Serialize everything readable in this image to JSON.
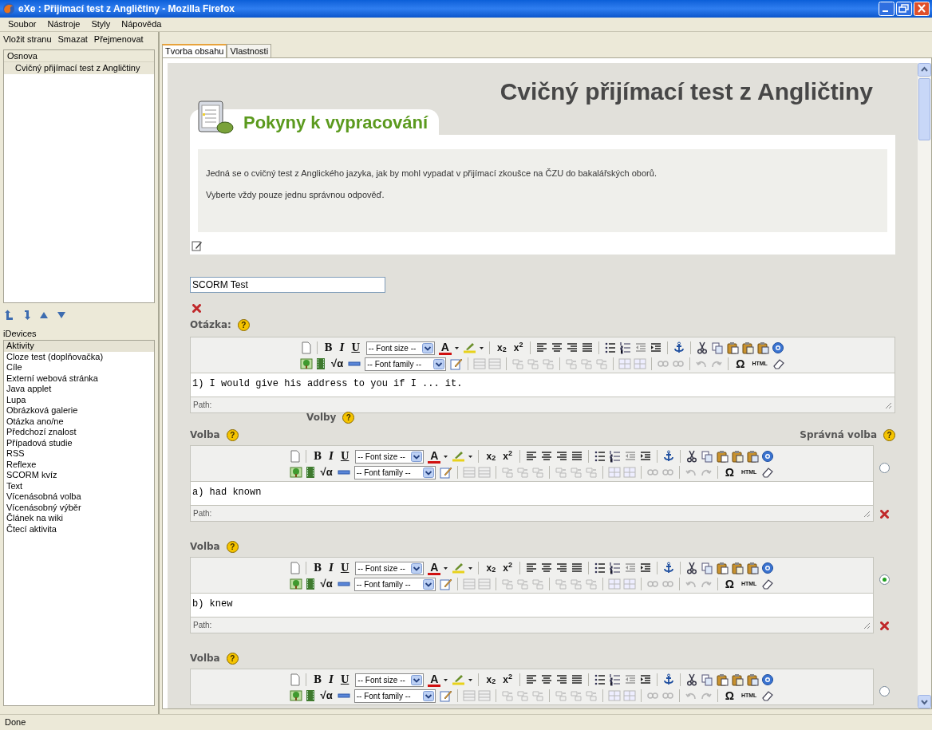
{
  "window": {
    "title": "eXe : Přijímací test z Angličtiny - Mozilla Firefox"
  },
  "menu": [
    "Soubor",
    "Nástroje",
    "Styly",
    "Nápověda"
  ],
  "outline_toolbar": [
    "Vložit stranu",
    "Smazat",
    "Přejmenovat"
  ],
  "outline": {
    "title": "Osnova",
    "children": [
      {
        "label": "Cvičný přijímací test z Angličtiny",
        "selected": true
      }
    ]
  },
  "idevices": {
    "title": "iDevices",
    "items": [
      {
        "label": "Aktivity",
        "selected": true
      },
      {
        "label": "Cloze test (doplňovačka)",
        "selected": false
      },
      {
        "label": "Cíle",
        "selected": false
      },
      {
        "label": "Externí webová stránka",
        "selected": false
      },
      {
        "label": "Java applet",
        "selected": false
      },
      {
        "label": "Lupa",
        "selected": false
      },
      {
        "label": "Obrázková galerie",
        "selected": false
      },
      {
        "label": "Otázka ano/ne",
        "selected": false
      },
      {
        "label": "Předchozí znalost",
        "selected": false
      },
      {
        "label": "Případová studie",
        "selected": false
      },
      {
        "label": "RSS",
        "selected": false
      },
      {
        "label": "Reflexe",
        "selected": false
      },
      {
        "label": "SCORM kvíz",
        "selected": false
      },
      {
        "label": "Text",
        "selected": false
      },
      {
        "label": "Vícenásobná volba",
        "selected": false
      },
      {
        "label": "Vícenásobný výběr",
        "selected": false
      },
      {
        "label": "Článek na wiki",
        "selected": false
      },
      {
        "label": "Čtecí aktivita",
        "selected": false
      }
    ]
  },
  "tabs": [
    {
      "label": "Tvorba obsahu",
      "selected": true
    },
    {
      "label": "Vlastnosti",
      "selected": false
    }
  ],
  "page": {
    "title": "Cvičný přijímací test z Angličtiny",
    "instructions": {
      "heading": "Pokyny k vypracování",
      "paragraphs": [
        "Jedná se o cvičný test z Anglického jazyka, jak by mohl vypadat v přijímací zkoušce na ČZU do bakalářských oborů.",
        "Vyberte vždy pouze jednu správnou odpověď."
      ]
    }
  },
  "scorm_title": {
    "value": "SCORM Test"
  },
  "question": {
    "label": "Otázka:",
    "help": "?",
    "editor": {
      "glyphs": [
        "B",
        "I",
        "U",
        "A",
        "x$_{2}$",
        "x$^{2}$",
        "√α",
        "Ω"
      ],
      "font_size": "-- Font size --",
      "font_family": "-- Font family --",
      "html": "HTML",
      "content": "1) I would give his address to you if I ... it.",
      "path": "Path:"
    }
  },
  "options_heading": {
    "label": "Volby",
    "help": "?"
  },
  "correct_heading": {
    "label": "Správná volba",
    "help": "?"
  },
  "options": [
    {
      "label": "Volba",
      "help": "?",
      "selected": false,
      "editor": {
        "glyphs": [
          "B",
          "I",
          "U",
          "A",
          "x$_{2}$",
          "x$^{2}$",
          "√α",
          "Ω"
        ],
        "font_size": "-- Font size --",
        "font_family": "-- Font family --",
        "html": "HTML",
        "content": "a) had known",
        "path": "Path:"
      }
    },
    {
      "label": "Volba",
      "help": "?",
      "selected": true,
      "editor": {
        "glyphs": [
          "B",
          "I",
          "U",
          "A",
          "x$_{2}$",
          "x$^{2}$",
          "√α",
          "Ω"
        ],
        "font_size": "-- Font size --",
        "font_family": "-- Font family --",
        "html": "HTML",
        "content": "b) knew",
        "path": "Path:"
      }
    },
    {
      "label": "Volba",
      "help": "?",
      "selected": false,
      "editor": {
        "glyphs": [
          "B",
          "I",
          "U",
          "A",
          "x$_{2}$",
          "x$^{2}$",
          "√α",
          "Ω"
        ],
        "font_size": "-- Font size --",
        "font_family": "-- Font family --",
        "html": "HTML"
      }
    }
  ],
  "status_bar": "Done"
}
